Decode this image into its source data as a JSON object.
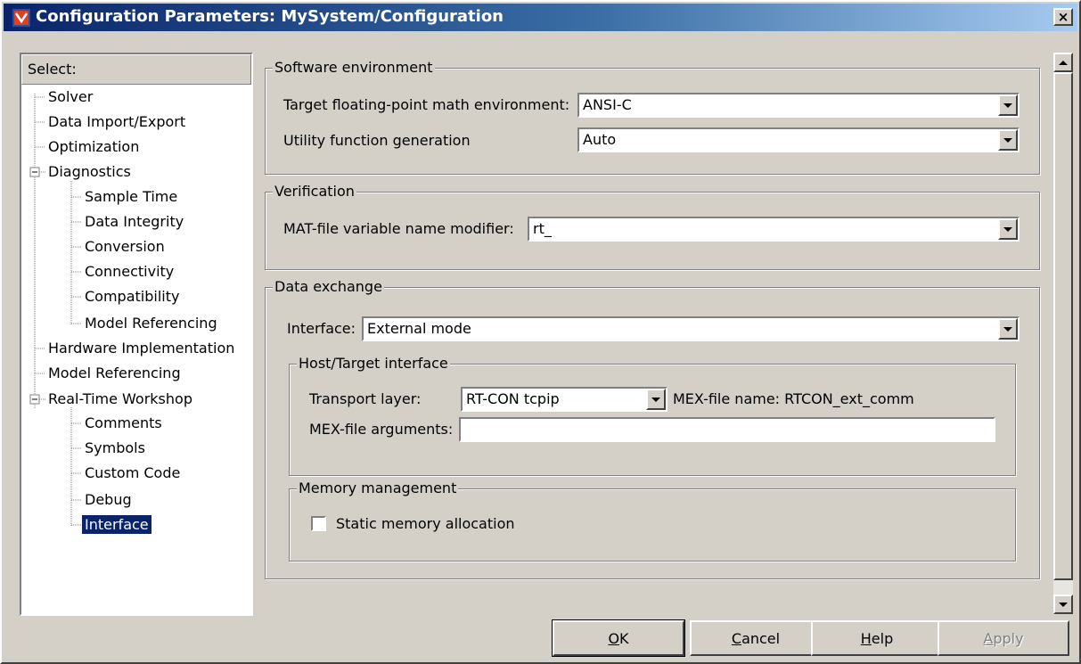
{
  "window": {
    "title": "Configuration Parameters: MySystem/Configuration",
    "close_label": "×"
  },
  "tree": {
    "header": "Select:",
    "items": [
      {
        "label": "Solver"
      },
      {
        "label": "Data Import/Export"
      },
      {
        "label": "Optimization"
      },
      {
        "label": "Diagnostics"
      },
      {
        "label": "Sample Time"
      },
      {
        "label": "Data Integrity"
      },
      {
        "label": "Conversion"
      },
      {
        "label": "Connectivity"
      },
      {
        "label": "Compatibility"
      },
      {
        "label": "Model Referencing"
      },
      {
        "label": "Hardware Implementation"
      },
      {
        "label": "Model Referencing"
      },
      {
        "label": "Real-Time Workshop"
      },
      {
        "label": "Comments"
      },
      {
        "label": "Symbols"
      },
      {
        "label": "Custom Code"
      },
      {
        "label": "Debug"
      },
      {
        "label": "Interface"
      }
    ],
    "selected": "Interface"
  },
  "software_environment": {
    "legend": "Software environment",
    "target_math_label": "Target floating-point math environment:",
    "target_math_value": "ANSI-C",
    "utility_label": "Utility function generation",
    "utility_value": "Auto"
  },
  "verification": {
    "legend": "Verification",
    "mat_label": "MAT-file variable name modifier:",
    "mat_value": "rt_"
  },
  "data_exchange": {
    "legend": "Data exchange",
    "interface_label": "Interface:",
    "interface_value": "External mode",
    "host_target": {
      "legend": "Host/Target interface",
      "transport_label": "Transport layer:",
      "transport_value": "RT-CON tcpip",
      "mex_name_text": "MEX-file name: RTCON_ext_comm",
      "mex_args_label": "MEX-file arguments:",
      "mex_args_value": ""
    },
    "memory": {
      "legend": "Memory management",
      "static_alloc_label": "Static memory allocation",
      "static_alloc_checked": false
    }
  },
  "buttons": {
    "ok": {
      "mnemonic": "O",
      "rest": "K"
    },
    "cancel": {
      "mnemonic": "C",
      "rest": "ancel"
    },
    "help": {
      "mnemonic": "H",
      "rest": "elp"
    },
    "apply": {
      "mnemonic": "A",
      "rest": "pply"
    }
  },
  "colors": {
    "dialog_bg": "#d4d0c8",
    "title_gradient_start": "#0a246a",
    "title_gradient_end": "#a6caf0",
    "selection": "#0a246a"
  }
}
